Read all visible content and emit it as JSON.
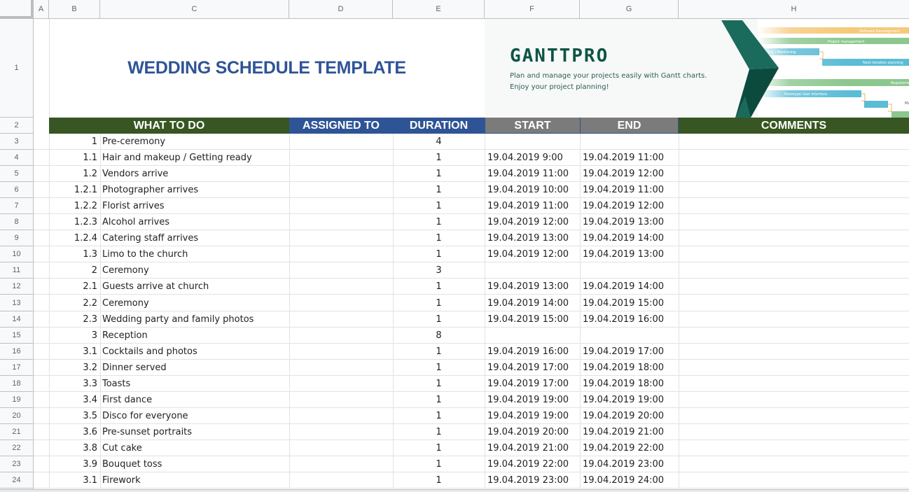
{
  "spreadsheet": {
    "column_headers": [
      "A",
      "B",
      "C",
      "D",
      "E",
      "F",
      "G",
      "H"
    ],
    "row_numbers": [
      "1",
      "2",
      "3",
      "4",
      "5",
      "6",
      "7",
      "8",
      "9",
      "10",
      "11",
      "12",
      "13",
      "14",
      "15",
      "16",
      "17",
      "18",
      "19",
      "20",
      "21",
      "22",
      "23",
      "24"
    ]
  },
  "title": "WEDDING SCHEDULE TEMPLATE",
  "banner": {
    "logo": "GANTTPRO",
    "tagline_1": "Plan and manage your projects easily with Gantt charts.",
    "tagline_2": "Enjoy your project planning!",
    "gantt_bars": [
      "Software Development",
      "Project management",
      "ing / Monitoring",
      "Next iteration planning",
      "Requirements",
      "Prototype User Interface",
      "Ma"
    ]
  },
  "table": {
    "headers": {
      "what_to_do": "WHAT TO DO",
      "assigned_to": "ASSIGNED TO",
      "duration": "DURATION",
      "start": "START",
      "end": "END",
      "comments": "COMMENTS"
    },
    "rows": [
      {
        "id": "1",
        "task": "Pre-ceremony",
        "assigned": "",
        "duration": "4",
        "start": "",
        "end": "",
        "comments": ""
      },
      {
        "id": "1.1",
        "task": "Hair and makeup / Getting ready",
        "assigned": "",
        "duration": "1",
        "start": "19.04.2019 9:00",
        "end": "19.04.2019 11:00",
        "comments": ""
      },
      {
        "id": "1.2",
        "task": "Vendors arrive",
        "assigned": "",
        "duration": "1",
        "start": "19.04.2019 11:00",
        "end": "19.04.2019 12:00",
        "comments": ""
      },
      {
        "id": "1.2.1",
        "task": "Photographer arrives",
        "assigned": "",
        "duration": "1",
        "start": "19.04.2019 10:00",
        "end": "19.04.2019 11:00",
        "comments": ""
      },
      {
        "id": "1.2.2",
        "task": "Florist arrives",
        "assigned": "",
        "duration": "1",
        "start": "19.04.2019 11:00",
        "end": "19.04.2019 12:00",
        "comments": ""
      },
      {
        "id": "1.2.3",
        "task": "Alcohol arrives",
        "assigned": "",
        "duration": "1",
        "start": "19.04.2019 12:00",
        "end": "19.04.2019 13:00",
        "comments": ""
      },
      {
        "id": "1.2.4",
        "task": "Catering staff arrives",
        "assigned": "",
        "duration": "1",
        "start": "19.04.2019 13:00",
        "end": "19.04.2019 14:00",
        "comments": ""
      },
      {
        "id": "1.3",
        "task": "Limo to the church",
        "assigned": "",
        "duration": "1",
        "start": "19.04.2019 12:00",
        "end": "19.04.2019 13:00",
        "comments": ""
      },
      {
        "id": "2",
        "task": "Ceremony",
        "assigned": "",
        "duration": "3",
        "start": "",
        "end": "",
        "comments": ""
      },
      {
        "id": "2.1",
        "task": "Guests arrive at church",
        "assigned": "",
        "duration": "1",
        "start": "19.04.2019 13:00",
        "end": "19.04.2019 14:00",
        "comments": ""
      },
      {
        "id": "2.2",
        "task": "Ceremony",
        "assigned": "",
        "duration": "1",
        "start": "19.04.2019 14:00",
        "end": "19.04.2019 15:00",
        "comments": ""
      },
      {
        "id": "2.3",
        "task": "Wedding party and family photos",
        "assigned": "",
        "duration": "1",
        "start": "19.04.2019 15:00",
        "end": "19.04.2019 16:00",
        "comments": ""
      },
      {
        "id": "3",
        "task": "Reception",
        "assigned": "",
        "duration": "8",
        "start": "",
        "end": "",
        "comments": ""
      },
      {
        "id": "3.1",
        "task": "Cocktails and photos",
        "assigned": "",
        "duration": "1",
        "start": "19.04.2019 16:00",
        "end": "19.04.2019 17:00",
        "comments": ""
      },
      {
        "id": "3.2",
        "task": "Dinner served",
        "assigned": "",
        "duration": "1",
        "start": "19.04.2019 17:00",
        "end": "19.04.2019 18:00",
        "comments": ""
      },
      {
        "id": "3.3",
        "task": "Toasts",
        "assigned": "",
        "duration": "1",
        "start": "19.04.2019 17:00",
        "end": "19.04.2019 18:00",
        "comments": ""
      },
      {
        "id": "3.4",
        "task": "First dance",
        "assigned": "",
        "duration": "1",
        "start": "19.04.2019 19:00",
        "end": "19.04.2019 19:00",
        "comments": ""
      },
      {
        "id": "3.5",
        "task": "Disco for everyone",
        "assigned": "",
        "duration": "1",
        "start": "19.04.2019 19:00",
        "end": "19.04.2019 20:00",
        "comments": ""
      },
      {
        "id": "3.6",
        "task": "Pre-sunset portraits",
        "assigned": "",
        "duration": "1",
        "start": "19.04.2019 20:00",
        "end": "19.04.2019 21:00",
        "comments": ""
      },
      {
        "id": "3.8",
        "task": "Cut cake",
        "assigned": "",
        "duration": "1",
        "start": "19.04.2019 21:00",
        "end": "19.04.2019 22:00",
        "comments": ""
      },
      {
        "id": "3.9",
        "task": "Bouquet toss",
        "assigned": "",
        "duration": "1",
        "start": "19.04.2019 22:00",
        "end": "19.04.2019 23:00",
        "comments": ""
      },
      {
        "id": "3.1",
        "task": "Firework",
        "assigned": "",
        "duration": "1",
        "start": "19.04.2019 23:00",
        "end": "19.04.2019 24:00",
        "comments": ""
      }
    ]
  },
  "colors": {
    "title_blue": "#2f5496",
    "header_green": "#375623",
    "header_blue": "#2f5496",
    "header_gray": "#7b7b7b",
    "brand_teal": "#0e5545"
  }
}
